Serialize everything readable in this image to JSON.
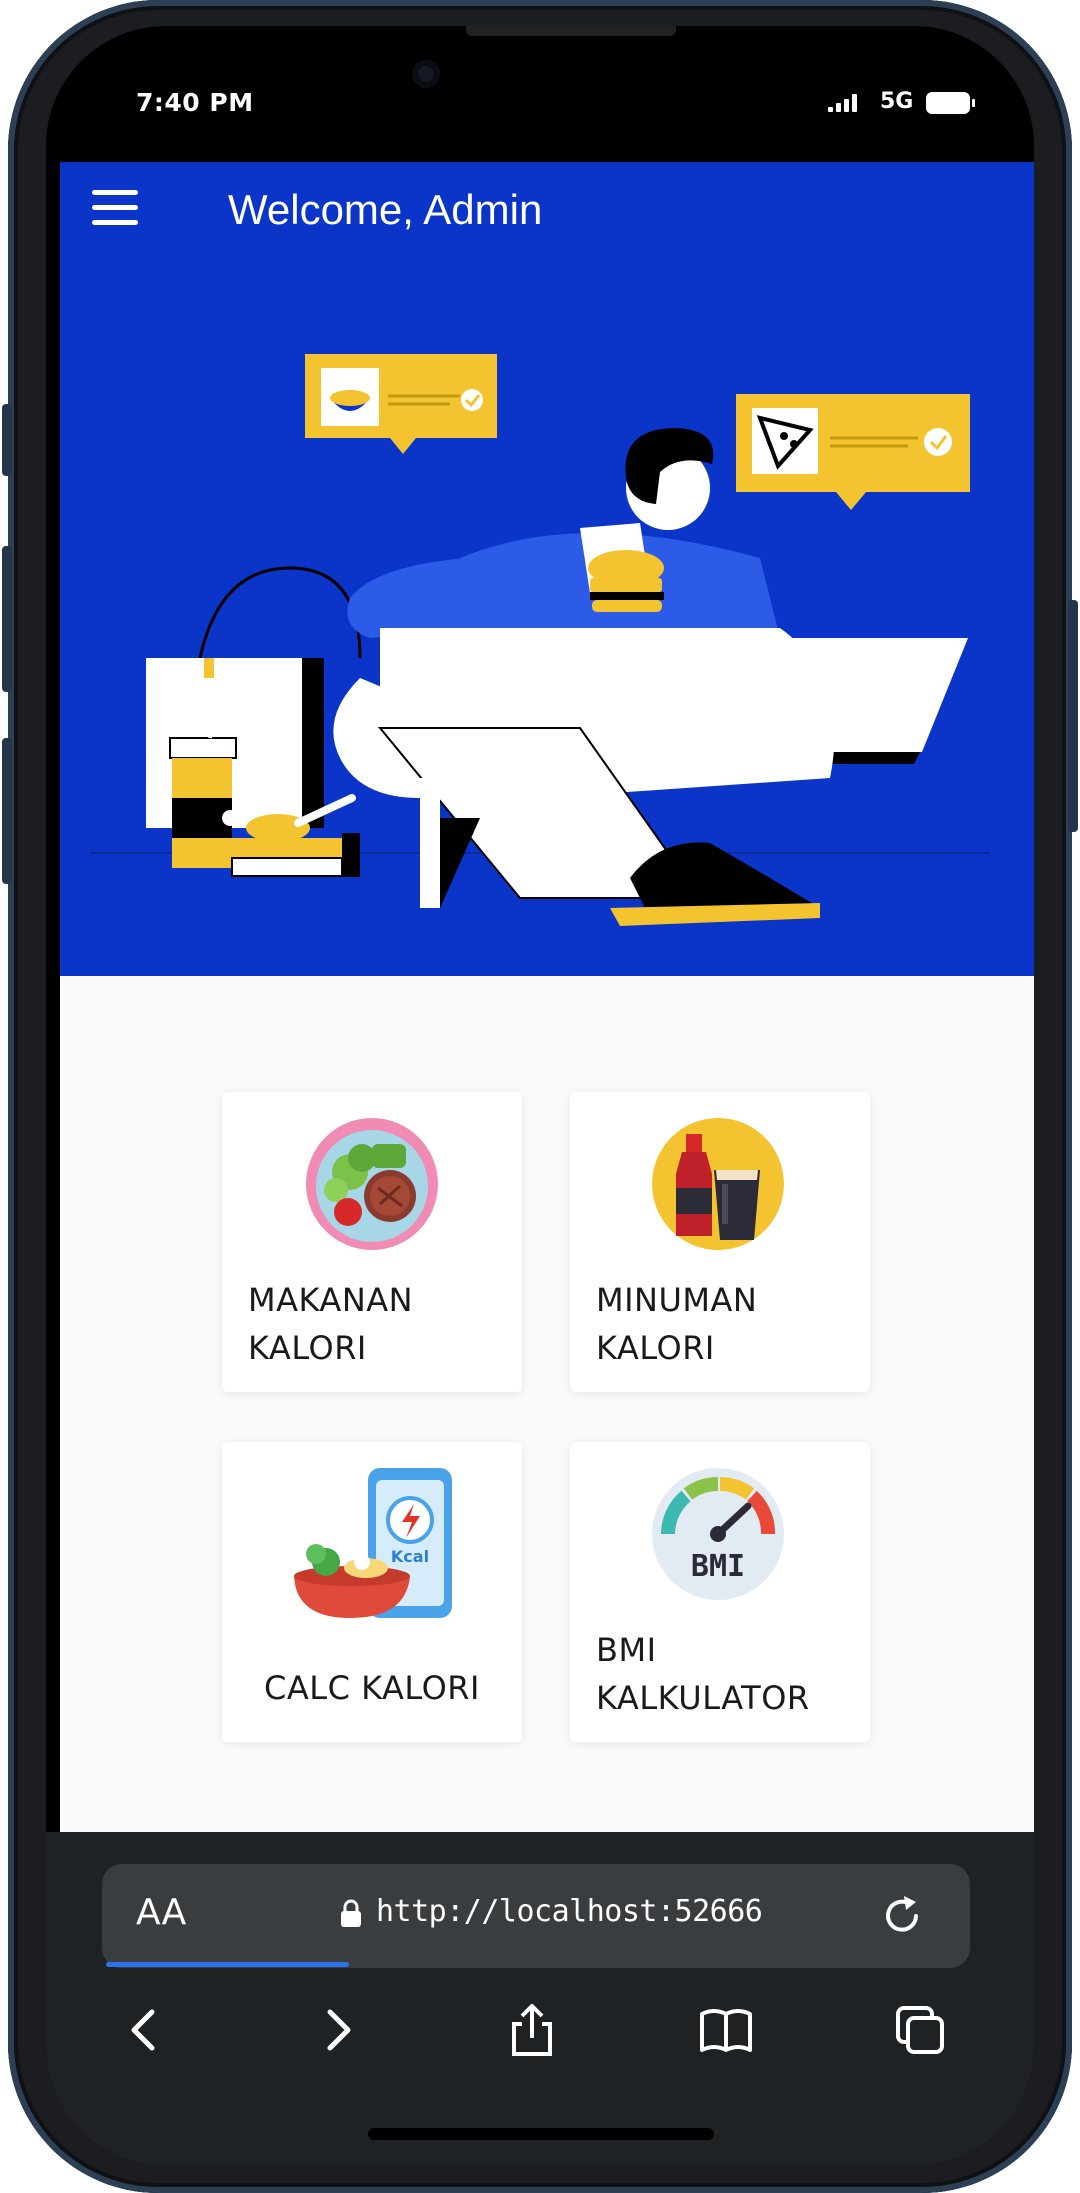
{
  "status_bar": {
    "time": "7:40 PM",
    "network": "5G"
  },
  "app_bar": {
    "title": "Welcome, Admin",
    "menu_icon": "hamburger-menu-icon",
    "background": "#0a35c8"
  },
  "menu": [
    {
      "label": "MAKANAN\nKALORI",
      "icon": "salad-plate-icon"
    },
    {
      "label": "MINUMAN\nKALORI",
      "icon": "drinks-bottle-icon"
    },
    {
      "label": "CALC KALORI",
      "icon": "kcal-calculator-icon",
      "icon_text": "Kcal"
    },
    {
      "label": "BMI\nKALKULATOR",
      "icon": "bmi-gauge-icon",
      "icon_text": "BMI"
    }
  ],
  "browser": {
    "text_size_label": "AA",
    "url": "http://localhost:52666",
    "load_progress": 0.28
  },
  "colors": {
    "accent": "#0a35c8",
    "highlight": "#f4c430",
    "card_background": "#ffffff",
    "page_background": "#fafafa",
    "browser_chrome": "#1f2224"
  }
}
